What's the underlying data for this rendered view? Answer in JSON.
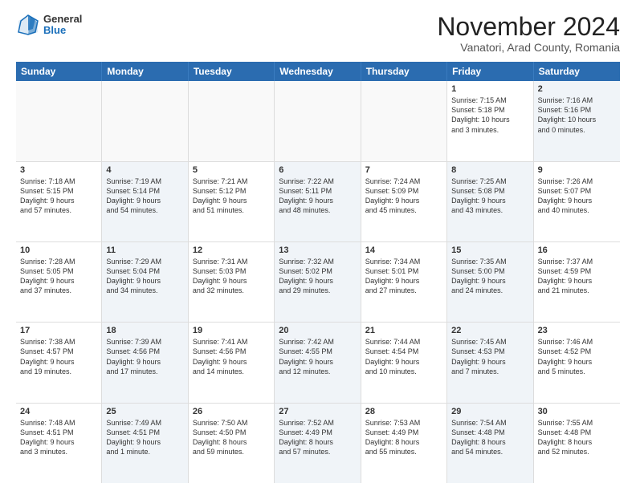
{
  "logo": {
    "general": "General",
    "blue": "Blue"
  },
  "title": "November 2024",
  "location": "Vanatori, Arad County, Romania",
  "header_days": [
    "Sunday",
    "Monday",
    "Tuesday",
    "Wednesday",
    "Thursday",
    "Friday",
    "Saturday"
  ],
  "rows": [
    [
      {
        "day": "",
        "info": "",
        "shaded": false,
        "empty": true
      },
      {
        "day": "",
        "info": "",
        "shaded": false,
        "empty": true
      },
      {
        "day": "",
        "info": "",
        "shaded": false,
        "empty": true
      },
      {
        "day": "",
        "info": "",
        "shaded": false,
        "empty": true
      },
      {
        "day": "",
        "info": "",
        "shaded": false,
        "empty": true
      },
      {
        "day": "1",
        "info": "Sunrise: 7:15 AM\nSunset: 5:18 PM\nDaylight: 10 hours\nand 3 minutes.",
        "shaded": false,
        "empty": false
      },
      {
        "day": "2",
        "info": "Sunrise: 7:16 AM\nSunset: 5:16 PM\nDaylight: 10 hours\nand 0 minutes.",
        "shaded": true,
        "empty": false
      }
    ],
    [
      {
        "day": "3",
        "info": "Sunrise: 7:18 AM\nSunset: 5:15 PM\nDaylight: 9 hours\nand 57 minutes.",
        "shaded": false,
        "empty": false
      },
      {
        "day": "4",
        "info": "Sunrise: 7:19 AM\nSunset: 5:14 PM\nDaylight: 9 hours\nand 54 minutes.",
        "shaded": true,
        "empty": false
      },
      {
        "day": "5",
        "info": "Sunrise: 7:21 AM\nSunset: 5:12 PM\nDaylight: 9 hours\nand 51 minutes.",
        "shaded": false,
        "empty": false
      },
      {
        "day": "6",
        "info": "Sunrise: 7:22 AM\nSunset: 5:11 PM\nDaylight: 9 hours\nand 48 minutes.",
        "shaded": true,
        "empty": false
      },
      {
        "day": "7",
        "info": "Sunrise: 7:24 AM\nSunset: 5:09 PM\nDaylight: 9 hours\nand 45 minutes.",
        "shaded": false,
        "empty": false
      },
      {
        "day": "8",
        "info": "Sunrise: 7:25 AM\nSunset: 5:08 PM\nDaylight: 9 hours\nand 43 minutes.",
        "shaded": true,
        "empty": false
      },
      {
        "day": "9",
        "info": "Sunrise: 7:26 AM\nSunset: 5:07 PM\nDaylight: 9 hours\nand 40 minutes.",
        "shaded": false,
        "empty": false
      }
    ],
    [
      {
        "day": "10",
        "info": "Sunrise: 7:28 AM\nSunset: 5:05 PM\nDaylight: 9 hours\nand 37 minutes.",
        "shaded": false,
        "empty": false
      },
      {
        "day": "11",
        "info": "Sunrise: 7:29 AM\nSunset: 5:04 PM\nDaylight: 9 hours\nand 34 minutes.",
        "shaded": true,
        "empty": false
      },
      {
        "day": "12",
        "info": "Sunrise: 7:31 AM\nSunset: 5:03 PM\nDaylight: 9 hours\nand 32 minutes.",
        "shaded": false,
        "empty": false
      },
      {
        "day": "13",
        "info": "Sunrise: 7:32 AM\nSunset: 5:02 PM\nDaylight: 9 hours\nand 29 minutes.",
        "shaded": true,
        "empty": false
      },
      {
        "day": "14",
        "info": "Sunrise: 7:34 AM\nSunset: 5:01 PM\nDaylight: 9 hours\nand 27 minutes.",
        "shaded": false,
        "empty": false
      },
      {
        "day": "15",
        "info": "Sunrise: 7:35 AM\nSunset: 5:00 PM\nDaylight: 9 hours\nand 24 minutes.",
        "shaded": true,
        "empty": false
      },
      {
        "day": "16",
        "info": "Sunrise: 7:37 AM\nSunset: 4:59 PM\nDaylight: 9 hours\nand 21 minutes.",
        "shaded": false,
        "empty": false
      }
    ],
    [
      {
        "day": "17",
        "info": "Sunrise: 7:38 AM\nSunset: 4:57 PM\nDaylight: 9 hours\nand 19 minutes.",
        "shaded": false,
        "empty": false
      },
      {
        "day": "18",
        "info": "Sunrise: 7:39 AM\nSunset: 4:56 PM\nDaylight: 9 hours\nand 17 minutes.",
        "shaded": true,
        "empty": false
      },
      {
        "day": "19",
        "info": "Sunrise: 7:41 AM\nSunset: 4:56 PM\nDaylight: 9 hours\nand 14 minutes.",
        "shaded": false,
        "empty": false
      },
      {
        "day": "20",
        "info": "Sunrise: 7:42 AM\nSunset: 4:55 PM\nDaylight: 9 hours\nand 12 minutes.",
        "shaded": true,
        "empty": false
      },
      {
        "day": "21",
        "info": "Sunrise: 7:44 AM\nSunset: 4:54 PM\nDaylight: 9 hours\nand 10 minutes.",
        "shaded": false,
        "empty": false
      },
      {
        "day": "22",
        "info": "Sunrise: 7:45 AM\nSunset: 4:53 PM\nDaylight: 9 hours\nand 7 minutes.",
        "shaded": true,
        "empty": false
      },
      {
        "day": "23",
        "info": "Sunrise: 7:46 AM\nSunset: 4:52 PM\nDaylight: 9 hours\nand 5 minutes.",
        "shaded": false,
        "empty": false
      }
    ],
    [
      {
        "day": "24",
        "info": "Sunrise: 7:48 AM\nSunset: 4:51 PM\nDaylight: 9 hours\nand 3 minutes.",
        "shaded": false,
        "empty": false
      },
      {
        "day": "25",
        "info": "Sunrise: 7:49 AM\nSunset: 4:51 PM\nDaylight: 9 hours\nand 1 minute.",
        "shaded": true,
        "empty": false
      },
      {
        "day": "26",
        "info": "Sunrise: 7:50 AM\nSunset: 4:50 PM\nDaylight: 8 hours\nand 59 minutes.",
        "shaded": false,
        "empty": false
      },
      {
        "day": "27",
        "info": "Sunrise: 7:52 AM\nSunset: 4:49 PM\nDaylight: 8 hours\nand 57 minutes.",
        "shaded": true,
        "empty": false
      },
      {
        "day": "28",
        "info": "Sunrise: 7:53 AM\nSunset: 4:49 PM\nDaylight: 8 hours\nand 55 minutes.",
        "shaded": false,
        "empty": false
      },
      {
        "day": "29",
        "info": "Sunrise: 7:54 AM\nSunset: 4:48 PM\nDaylight: 8 hours\nand 54 minutes.",
        "shaded": true,
        "empty": false
      },
      {
        "day": "30",
        "info": "Sunrise: 7:55 AM\nSunset: 4:48 PM\nDaylight: 8 hours\nand 52 minutes.",
        "shaded": false,
        "empty": false
      }
    ]
  ]
}
